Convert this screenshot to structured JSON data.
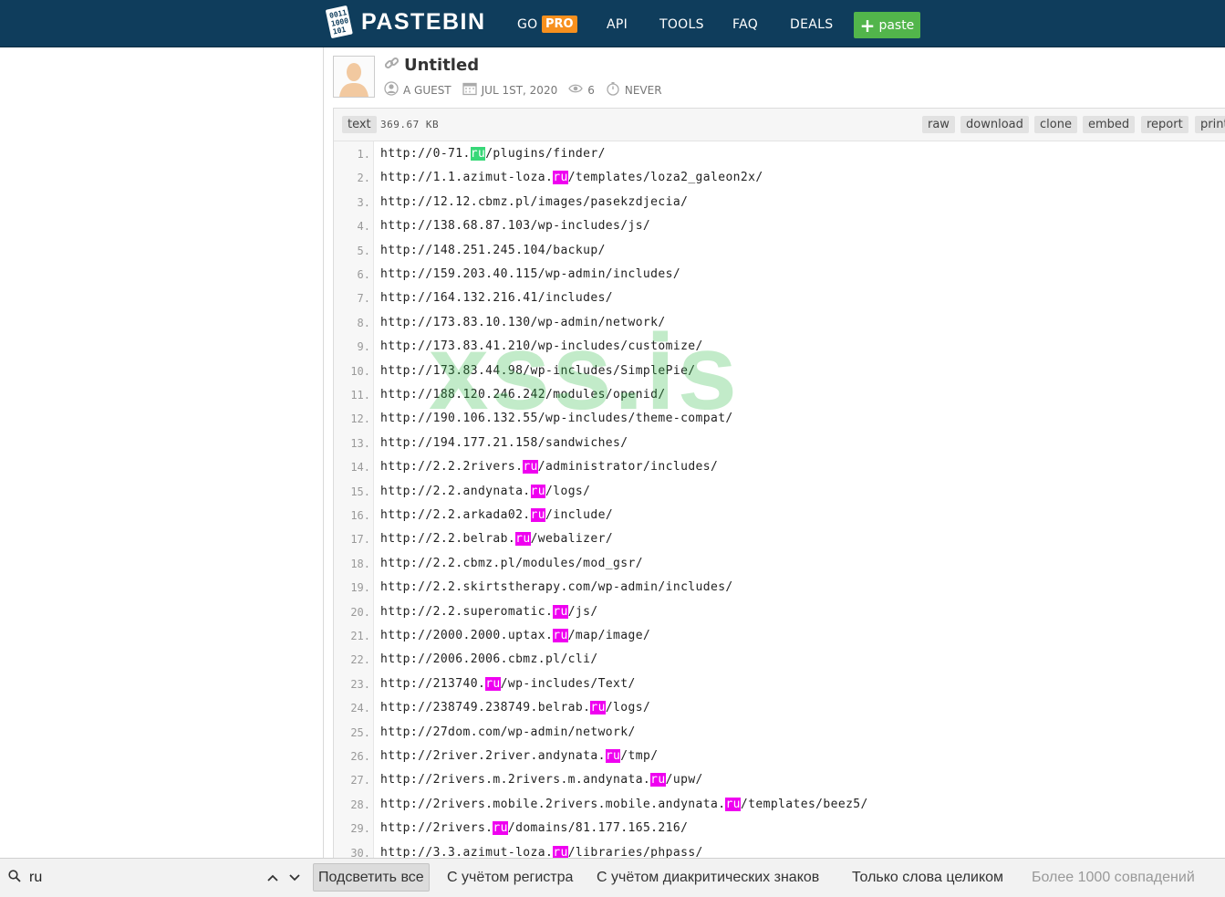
{
  "header": {
    "logo_text": "PASTEBIN",
    "nav": [
      {
        "label": "GO"
      },
      {
        "label": "API"
      },
      {
        "label": "TOOLS"
      },
      {
        "label": "FAQ"
      },
      {
        "label": "DEALS"
      }
    ],
    "pro_badge": "PRO",
    "paste_button": "paste"
  },
  "paste": {
    "title": "Untitled",
    "author": "A GUEST",
    "date": "JUL 1ST, 2020",
    "views": "6",
    "expire": "NEVER"
  },
  "toolbar": {
    "syntax": "text",
    "size": "369.67 KB",
    "actions": [
      "raw",
      "download",
      "clone",
      "embed",
      "report",
      "print"
    ]
  },
  "code_lines": [
    "http://0-71.ru/plugins/finder/",
    "http://1.1.azimut-loza.ru/templates/loza2_galeon2x/",
    "http://12.12.cbmz.pl/images/pasekzdjecia/",
    "http://138.68.87.103/wp-includes/js/",
    "http://148.251.245.104/backup/",
    "http://159.203.40.115/wp-admin/includes/",
    "http://164.132.216.41/includes/",
    "http://173.83.10.130/wp-admin/network/",
    "http://173.83.41.210/wp-includes/customize/",
    "http://173.83.44.98/wp-includes/SimplePie/",
    "http://188.120.246.242/modules/openid/",
    "http://190.106.132.55/wp-includes/theme-compat/",
    "http://194.177.21.158/sandwiches/",
    "http://2.2.2rivers.ru/administrator/includes/",
    "http://2.2.andynata.ru/logs/",
    "http://2.2.arkada02.ru/include/",
    "http://2.2.belrab.ru/webalizer/",
    "http://2.2.cbmz.pl/modules/mod_gsr/",
    "http://2.2.skirtstherapy.com/wp-admin/includes/",
    "http://2.2.superomatic.ru/js/",
    "http://2000.2000.uptax.ru/map/image/",
    "http://2006.2006.cbmz.pl/cli/",
    "http://213740.ru/wp-includes/Text/",
    "http://238749.238749.belrab.ru/logs/",
    "http://27dom.com/wp-admin/network/",
    "http://2river.2river.andynata.ru/tmp/",
    "http://2rivers.m.2rivers.m.andynata.ru/upw/",
    "http://2rivers.mobile.2rivers.mobile.andynata.ru/templates/beez5/",
    "http://2rivers.ru/domains/81.177.165.216/",
    "http://3.3.azimut-loza.ru/libraries/phpass/"
  ],
  "watermark": "xss.is",
  "findbar": {
    "query": "ru",
    "highlight_all": "Подсветить все",
    "match_case": "С учётом регистра",
    "match_diacritics": "С учётом диакритических знаков",
    "whole_words": "Только слова целиком",
    "status": "Более 1000 совпадений"
  },
  "colors": {
    "header_bg": "#0f3d5c",
    "pro_badge": "#f7901e",
    "paste_button": "#52b54b",
    "find_highlight": "#ef00f0",
    "find_current": "#38d878"
  },
  "icons": [
    "logo-icon",
    "link-icon",
    "user-icon",
    "calendar-icon",
    "eye-icon",
    "timer-icon",
    "search-icon",
    "chevron-up-icon",
    "chevron-down-icon",
    "plus-icon"
  ]
}
